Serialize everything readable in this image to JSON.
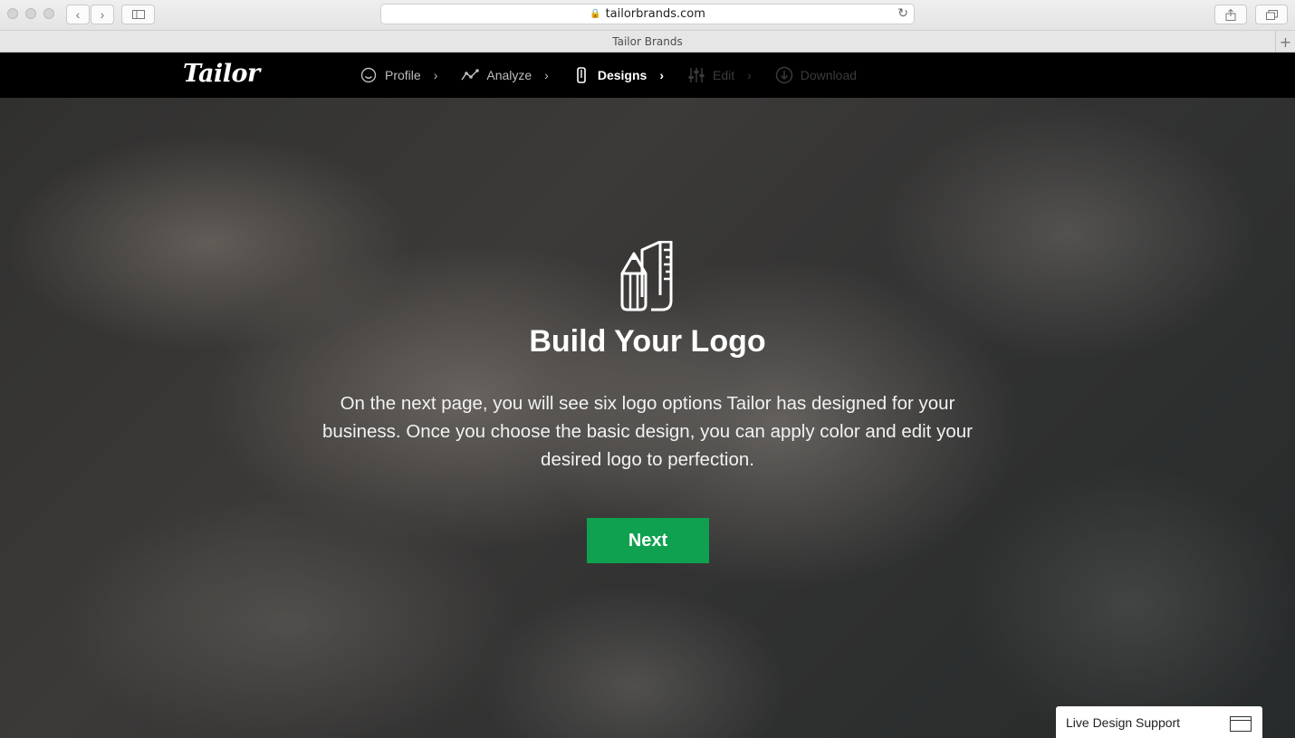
{
  "browser": {
    "url": "tailorbrands.com",
    "tab_title": "Tailor Brands"
  },
  "nav": {
    "brand": "Tailor",
    "steps": [
      {
        "label": "Profile",
        "state": "done",
        "icon": "face-icon"
      },
      {
        "label": "Analyze",
        "state": "done",
        "icon": "analyze-icon"
      },
      {
        "label": "Designs",
        "state": "active",
        "icon": "designs-icon"
      },
      {
        "label": "Edit",
        "state": "disabled",
        "icon": "sliders-icon"
      },
      {
        "label": "Download",
        "state": "disabled",
        "icon": "download-icon"
      }
    ]
  },
  "hero": {
    "icon": "pencil-ruler-icon",
    "title": "Build Your Logo",
    "description": "On the next page, you will see six logo options Tailor has designed for your business. Once you choose the basic design, you can apply color and edit your desired logo to perfection.",
    "next_label": "Next",
    "button_color": "#0fa14f"
  },
  "support": {
    "label": "Live Design Support"
  }
}
